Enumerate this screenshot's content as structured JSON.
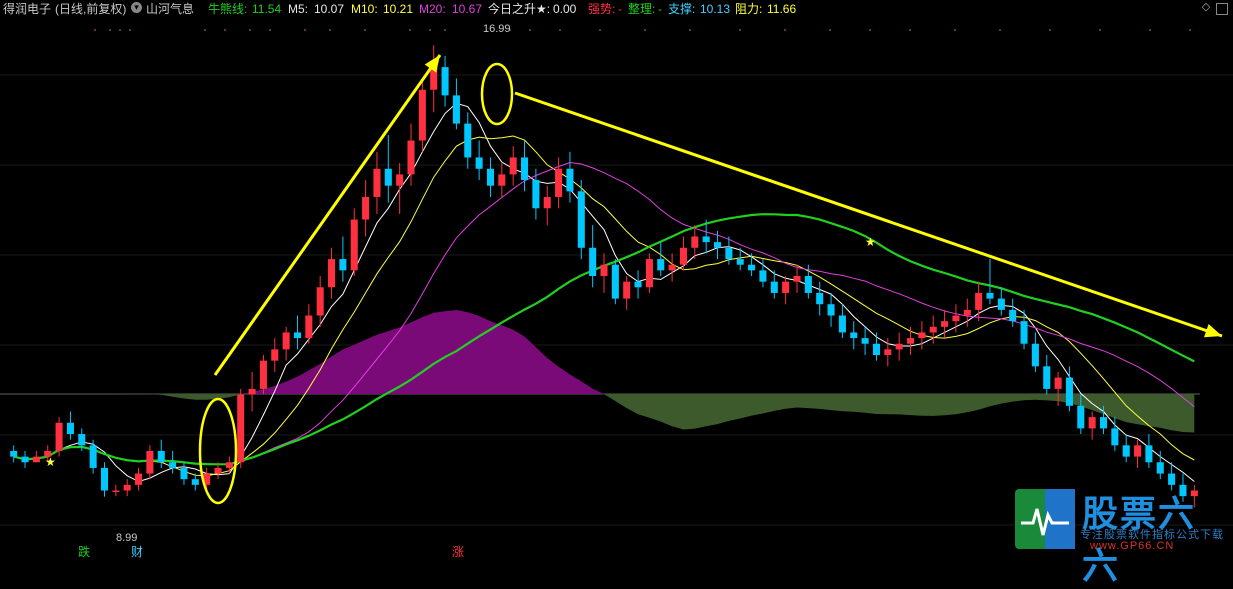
{
  "header": {
    "title": "得润电子",
    "period": "(日线,前复权)",
    "indicator_name": "山河气息",
    "bull_label": "牛熊线:",
    "bull_value": "11.54",
    "m5_label": "M5:",
    "m5_value": "10.07",
    "m10_label": "M10:",
    "m10_value": "10.21",
    "m20_label": "M20:",
    "m20_value": "10.67",
    "today_label": "今日之升★:",
    "today_value": "0.00",
    "strong_label": "强势:",
    "strong_value": "-",
    "consol_label": "整理:",
    "consol_value": "-",
    "support_label": "支撑:",
    "support_value": "10.13",
    "resist_label": "阻力:",
    "resist_value": "11.66"
  },
  "colors": {
    "up": "#ff3040",
    "down": "#00c8ff",
    "bull_line": "#20d020",
    "m5": "#ffffff",
    "m10": "#ffff40",
    "m20": "#e040e0",
    "osc_pos": "#7a0a78",
    "osc_neg": "#3c5a2c",
    "arrow": "#ffff00"
  },
  "annotations": {
    "high_label": "16.99",
    "low_label": "8.99",
    "marker_die": "跌",
    "marker_cai": "财",
    "marker_zhang": "涨"
  },
  "watermark": {
    "brand": "股票六六",
    "slogan": "专注股票软件指标公式下载",
    "url": "www.GP66.CN"
  },
  "chart_data": {
    "type": "candlestick",
    "title": "得润电子 (日线,前复权)",
    "price_high": 16.99,
    "price_low": 8.99,
    "indicators": {
      "牛熊线": 11.54,
      "M5": 10.07,
      "M10": 10.21,
      "M20": 10.67,
      "支撑": 10.13,
      "阻力": 11.66
    },
    "ylim": [
      8.4,
      17.4
    ],
    "candles": [
      [
        9.8,
        9.9,
        9.6,
        9.7
      ],
      [
        9.7,
        9.8,
        9.5,
        9.6
      ],
      [
        9.6,
        9.8,
        9.6,
        9.7
      ],
      [
        9.7,
        9.9,
        9.6,
        9.8
      ],
      [
        9.8,
        10.4,
        9.7,
        10.3
      ],
      [
        10.3,
        10.5,
        10.0,
        10.1
      ],
      [
        10.1,
        10.2,
        9.8,
        9.9
      ],
      [
        9.9,
        10.0,
        9.4,
        9.5
      ],
      [
        9.5,
        9.6,
        8.99,
        9.1
      ],
      [
        9.1,
        9.2,
        9.0,
        9.1
      ],
      [
        9.1,
        9.3,
        9.0,
        9.2
      ],
      [
        9.2,
        9.5,
        9.1,
        9.4
      ],
      [
        9.4,
        9.9,
        9.3,
        9.8
      ],
      [
        9.8,
        10.0,
        9.5,
        9.6
      ],
      [
        9.6,
        9.8,
        9.4,
        9.5
      ],
      [
        9.5,
        9.6,
        9.2,
        9.3
      ],
      [
        9.3,
        9.4,
        9.1,
        9.2
      ],
      [
        9.2,
        9.5,
        9.1,
        9.4
      ],
      [
        9.4,
        9.6,
        9.3,
        9.5
      ],
      [
        9.5,
        9.7,
        9.4,
        9.6
      ],
      [
        9.6,
        10.9,
        9.5,
        10.8
      ],
      [
        10.8,
        11.2,
        10.5,
        10.9
      ],
      [
        10.9,
        11.5,
        10.8,
        11.4
      ],
      [
        11.4,
        11.8,
        11.2,
        11.6
      ],
      [
        11.6,
        12.0,
        11.4,
        11.9
      ],
      [
        11.9,
        12.2,
        11.6,
        11.8
      ],
      [
        11.8,
        12.4,
        11.7,
        12.2
      ],
      [
        12.2,
        12.9,
        12.0,
        12.7
      ],
      [
        12.7,
        13.4,
        12.5,
        13.2
      ],
      [
        13.2,
        13.6,
        12.8,
        13.0
      ],
      [
        13.0,
        14.1,
        12.9,
        13.9
      ],
      [
        13.9,
        14.6,
        13.6,
        14.3
      ],
      [
        14.3,
        15.1,
        14.0,
        14.8
      ],
      [
        14.8,
        15.4,
        14.2,
        14.5
      ],
      [
        14.5,
        14.9,
        14.0,
        14.7
      ],
      [
        14.7,
        15.6,
        14.5,
        15.3
      ],
      [
        15.3,
        16.4,
        15.1,
        16.2
      ],
      [
        16.2,
        16.99,
        15.8,
        16.6
      ],
      [
        16.6,
        16.8,
        15.9,
        16.1
      ],
      [
        16.1,
        16.4,
        15.5,
        15.6
      ],
      [
        15.6,
        15.8,
        14.8,
        15.0
      ],
      [
        15.0,
        15.3,
        14.6,
        14.8
      ],
      [
        14.8,
        15.0,
        14.3,
        14.5
      ],
      [
        14.5,
        14.9,
        14.3,
        14.7
      ],
      [
        14.7,
        15.2,
        14.5,
        15.0
      ],
      [
        15.0,
        15.3,
        14.4,
        14.6
      ],
      [
        14.6,
        14.8,
        13.9,
        14.1
      ],
      [
        14.1,
        14.5,
        13.8,
        14.3
      ],
      [
        14.3,
        15.0,
        14.1,
        14.8
      ],
      [
        14.8,
        15.1,
        14.2,
        14.4
      ],
      [
        14.4,
        14.6,
        13.2,
        13.4
      ],
      [
        13.4,
        13.8,
        12.7,
        12.9
      ],
      [
        12.9,
        13.3,
        12.6,
        13.1
      ],
      [
        13.1,
        13.2,
        12.4,
        12.5
      ],
      [
        12.5,
        12.9,
        12.3,
        12.8
      ],
      [
        12.8,
        13.0,
        12.5,
        12.7
      ],
      [
        12.7,
        13.3,
        12.6,
        13.2
      ],
      [
        13.2,
        13.5,
        12.9,
        13.0
      ],
      [
        13.0,
        13.3,
        12.8,
        13.1
      ],
      [
        13.1,
        13.6,
        13.0,
        13.4
      ],
      [
        13.4,
        13.8,
        13.2,
        13.6
      ],
      [
        13.6,
        13.9,
        13.3,
        13.5
      ],
      [
        13.5,
        13.7,
        13.2,
        13.4
      ],
      [
        13.4,
        13.6,
        13.1,
        13.2
      ],
      [
        13.2,
        13.4,
        13.0,
        13.1
      ],
      [
        13.1,
        13.3,
        12.9,
        13.0
      ],
      [
        13.0,
        13.2,
        12.7,
        12.8
      ],
      [
        12.8,
        13.0,
        12.5,
        12.6
      ],
      [
        12.6,
        12.9,
        12.4,
        12.8
      ],
      [
        12.8,
        13.1,
        12.6,
        12.9
      ],
      [
        12.9,
        13.1,
        12.5,
        12.6
      ],
      [
        12.6,
        12.8,
        12.2,
        12.4
      ],
      [
        12.4,
        12.6,
        12.0,
        12.2
      ],
      [
        12.2,
        12.4,
        11.8,
        11.9
      ],
      [
        11.9,
        12.1,
        11.6,
        11.8
      ],
      [
        11.8,
        12.0,
        11.5,
        11.7
      ],
      [
        11.7,
        11.9,
        11.4,
        11.5
      ],
      [
        11.5,
        11.8,
        11.3,
        11.6
      ],
      [
        11.6,
        11.9,
        11.4,
        11.7
      ],
      [
        11.7,
        12.0,
        11.5,
        11.8
      ],
      [
        11.8,
        12.1,
        11.6,
        11.9
      ],
      [
        11.9,
        12.2,
        11.7,
        12.0
      ],
      [
        12.0,
        12.3,
        11.8,
        12.1
      ],
      [
        12.1,
        12.4,
        11.9,
        12.2
      ],
      [
        12.2,
        12.5,
        12.0,
        12.3
      ],
      [
        12.3,
        12.8,
        12.1,
        12.6
      ],
      [
        12.6,
        13.2,
        12.4,
        12.5
      ],
      [
        12.5,
        12.7,
        12.2,
        12.3
      ],
      [
        12.3,
        12.5,
        12.0,
        12.1
      ],
      [
        12.1,
        12.3,
        11.6,
        11.7
      ],
      [
        11.7,
        11.9,
        11.2,
        11.3
      ],
      [
        11.3,
        11.5,
        10.8,
        10.9
      ],
      [
        10.9,
        11.2,
        10.6,
        11.1
      ],
      [
        11.1,
        11.3,
        10.5,
        10.6
      ],
      [
        10.6,
        10.8,
        10.1,
        10.2
      ],
      [
        10.2,
        10.5,
        10.0,
        10.4
      ],
      [
        10.4,
        10.6,
        10.1,
        10.2
      ],
      [
        10.2,
        10.4,
        9.8,
        9.9
      ],
      [
        9.9,
        10.1,
        9.6,
        9.7
      ],
      [
        9.7,
        10.0,
        9.5,
        9.9
      ],
      [
        9.9,
        10.1,
        9.5,
        9.6
      ],
      [
        9.6,
        9.8,
        9.3,
        9.4
      ],
      [
        9.4,
        9.6,
        9.1,
        9.2
      ],
      [
        9.2,
        9.4,
        8.9,
        9.0
      ],
      [
        9.0,
        9.2,
        8.8,
        9.1
      ]
    ]
  }
}
